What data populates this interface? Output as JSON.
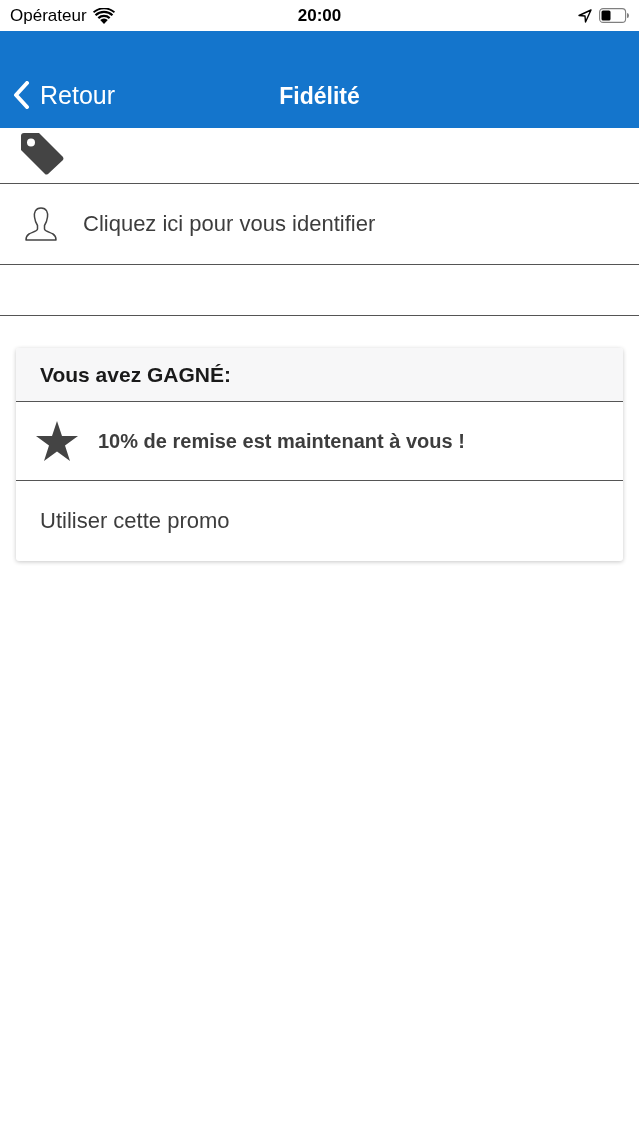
{
  "status_bar": {
    "carrier": "Opérateur",
    "time": "20:00"
  },
  "nav_bar": {
    "back_label": "Retour",
    "title": "Fidélité"
  },
  "login_row": {
    "label": "Cliquez ici pour vous identifier"
  },
  "reward_card": {
    "heading": "Vous avez GAGNÉ:",
    "items": [
      {
        "kind": "reward",
        "text": "10% de remise est maintenant à vous !"
      },
      {
        "kind": "action",
        "text": "Utiliser cette promo"
      }
    ]
  }
}
